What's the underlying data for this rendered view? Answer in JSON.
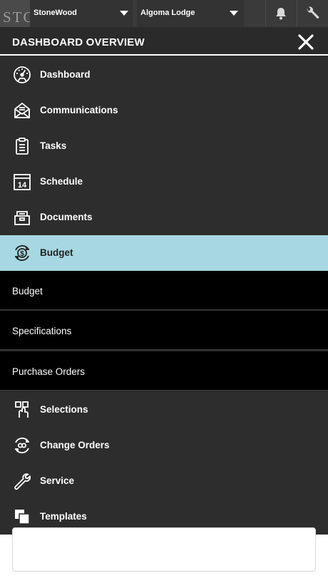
{
  "topbar": {
    "logo_text": "STC",
    "company_selector": "StoneWood",
    "job_selector": "Algoma Lodge"
  },
  "menu": {
    "title": "DASHBOARD OVERVIEW",
    "items_top": [
      {
        "label": "Dashboard",
        "icon": "dashboard-gauge-icon"
      },
      {
        "label": "Communications",
        "icon": "envelope-icon"
      },
      {
        "label": "Tasks",
        "icon": "clipboard-icon"
      },
      {
        "label": "Schedule",
        "icon": "calendar-icon"
      },
      {
        "label": "Documents",
        "icon": "file-drawer-icon"
      },
      {
        "label": "Budget",
        "icon": "dollar-cycle-icon",
        "active": true
      }
    ],
    "budget_subitems": [
      {
        "label": "Budget"
      },
      {
        "label": "Specifications"
      },
      {
        "label": "Purchase Orders"
      }
    ],
    "items_bottom": [
      {
        "label": "Selections",
        "icon": "selection-pointer-icon"
      },
      {
        "label": "Change Orders",
        "icon": "change-cycle-icon"
      },
      {
        "label": "Service",
        "icon": "wrench-icon"
      },
      {
        "label": "Templates",
        "icon": "templates-icon"
      }
    ],
    "calendar_icon_day": "14",
    "active_color": "#a7d8e1"
  }
}
